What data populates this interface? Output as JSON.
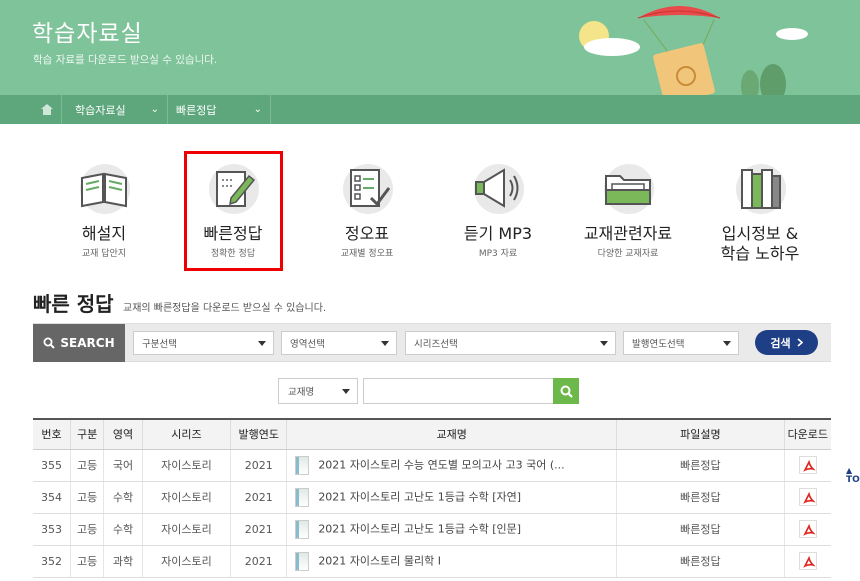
{
  "banner": {
    "title": "학습자료실",
    "subtitle": "학습 자료를 다운로드 받으실 수 있습니다."
  },
  "nav": {
    "home_icon": "home-icon",
    "items": [
      {
        "label": "학습자료실"
      },
      {
        "label": "빠른정답"
      }
    ]
  },
  "categories": [
    {
      "name": "해설지",
      "desc": "교재 답안지",
      "icon": "book-icon"
    },
    {
      "name": "빠른정답",
      "desc": "정확한 정답",
      "icon": "pencil-note-icon"
    },
    {
      "name": "정오표",
      "desc": "교재별 정오표",
      "icon": "checklist-icon"
    },
    {
      "name": "듣기 MP3",
      "desc": "MP3 자료",
      "icon": "speaker-icon"
    },
    {
      "name": "교재관련자료",
      "desc": "다양한 교재자료",
      "icon": "folder-icon"
    },
    {
      "name_line1": "입시정보 &",
      "name_line2": "학습 노하우",
      "icon": "books-icon"
    }
  ],
  "section": {
    "title": "빠른 정답",
    "subtitle": "교재의 빠른정답을 다운로드 받으실 수 있습니다."
  },
  "search": {
    "label": "SEARCH",
    "selects": [
      "구분선택",
      "영역선택",
      "시리즈선택",
      "발행연도선택"
    ],
    "button": "검색",
    "title_select": "교재명",
    "title_input_value": ""
  },
  "table": {
    "headers": [
      "번호",
      "구분",
      "영역",
      "시리즈",
      "발행연도",
      "교재명",
      "파일설명",
      "다운로드"
    ],
    "rows": [
      {
        "no": "355",
        "type": "고등",
        "area": "국어",
        "series": "자이스토리",
        "year": "2021",
        "title": "2021 자이스토리 수능 연도별 모의고사 고3 국어 (...",
        "file": "빠른정답"
      },
      {
        "no": "354",
        "type": "고등",
        "area": "수학",
        "series": "자이스토리",
        "year": "2021",
        "title": "2021 자이스토리 고난도 1등급 수학 [자연]",
        "file": "빠른정답"
      },
      {
        "no": "353",
        "type": "고등",
        "area": "수학",
        "series": "자이스토리",
        "year": "2021",
        "title": "2021 자이스토리 고난도 1등급 수학 [인문]",
        "file": "빠른정답"
      },
      {
        "no": "352",
        "type": "고등",
        "area": "과학",
        "series": "자이스토리",
        "year": "2021",
        "title": "2021 자이스토리 물리학 Ⅰ",
        "file": "빠른정답"
      }
    ]
  },
  "top_button": "TO",
  "colors": {
    "banner_bg": "#7fc39a",
    "nav_bg": "#5ea77d",
    "search_button": "#1e3f86",
    "go_button": "#6cb84a",
    "highlight": "#ee0000"
  }
}
